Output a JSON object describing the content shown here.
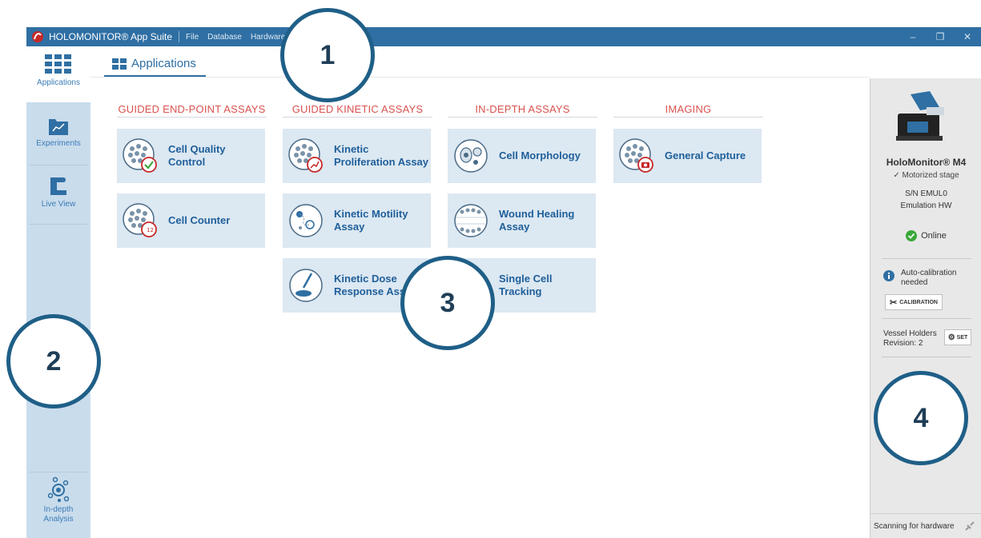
{
  "titlebar": {
    "app_name": "HOLOMONITOR® App Suite",
    "menus": [
      "File",
      "Database",
      "Hardware"
    ],
    "minimize": "–",
    "restore": "❐",
    "close": "✕"
  },
  "leftnav": {
    "applications": "Applications",
    "experiments": "Experiments",
    "live_view": "Live View",
    "indepth": "In-depth\nAnalysis"
  },
  "header": {
    "tab_label": "Applications"
  },
  "sections": {
    "guided_endpoint": "GUIDED END-POINT ASSAYS",
    "guided_kinetic": "GUIDED KINETIC ASSAYS",
    "indepth": "IN-DEPTH ASSAYS",
    "imaging": "IMAGING"
  },
  "tiles": {
    "cell_quality": "Cell Quality\nControl",
    "cell_counter": "Cell Counter",
    "kinetic_proliferation": "Kinetic\nProliferation Assay",
    "kinetic_motility": "Kinetic Motility\nAssay",
    "kinetic_dose": "Kinetic Dose\nResponse Assay",
    "cell_morphology": "Cell Morphology",
    "wound_healing": "Wound Healing\nAssay",
    "single_cell": "Single Cell\nTracking",
    "general_capture": "General Capture"
  },
  "device": {
    "name": "HoloMonitor® M4",
    "stage": "✓ Motorized stage",
    "serial": "S/N EMUL0",
    "mode": "Emulation HW",
    "status": "Online",
    "calib_msg": "Auto-calibration\nneeded",
    "calib_btn": "CALIBRATION",
    "vessel_label": "Vessel Holders",
    "vessel_rev": "Revision: 2",
    "set_btn": "SET",
    "scanning": "Scanning for hardware"
  },
  "callouts": [
    "1",
    "2",
    "3",
    "4"
  ],
  "colors": {
    "accent": "#2f6fa3",
    "tile_bg": "#dce8f2",
    "section_red": "#d9534f",
    "online_green": "#3aa83a"
  }
}
